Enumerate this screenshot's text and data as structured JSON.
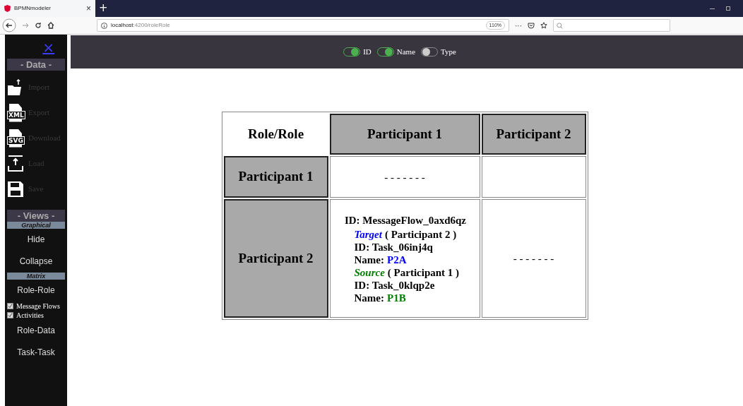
{
  "browser": {
    "tab_title": "BPMNmodeler",
    "tab_close": "×",
    "new_tab": "+",
    "url_host": "localhost",
    "url_path": ":4200/roleRole",
    "zoom": "110%",
    "more": "···"
  },
  "sidebar": {
    "close": "×",
    "data_header": "- Data -",
    "data_items": [
      {
        "kind": "import",
        "label": "Import",
        "disabled": true
      },
      {
        "kind": "xml",
        "badge": "XML",
        "label": "Export",
        "disabled": true
      },
      {
        "kind": "svg",
        "badge": "SVG",
        "label": "Download",
        "disabled": true
      },
      {
        "kind": "load",
        "label": "Load",
        "disabled": true
      },
      {
        "kind": "save",
        "label": "Save",
        "disabled": true
      }
    ],
    "views_header": "- Views -",
    "sections": [
      {
        "title": "Graphical",
        "items": [
          {
            "kind": "link",
            "label": "Hide"
          },
          {
            "kind": "link",
            "label": "Collapse"
          }
        ]
      },
      {
        "title": "Matrix",
        "items": [
          {
            "kind": "link",
            "label": "Role-Role"
          },
          {
            "kind": "checkbox",
            "label": "Message Flows",
            "checked": true
          },
          {
            "kind": "checkbox",
            "label": "Activities",
            "checked": true
          },
          {
            "kind": "link",
            "label": "Role-Data"
          },
          {
            "kind": "link",
            "label": "Task-Task"
          }
        ]
      }
    ]
  },
  "toggles": [
    {
      "label": "ID",
      "on": true
    },
    {
      "label": "Name",
      "on": true
    },
    {
      "label": "Type",
      "on": false
    }
  ],
  "matrix": {
    "corner": "Role/Role",
    "columns": [
      "Participant 1",
      "Participant 2"
    ],
    "rows": [
      {
        "header": "Participant 1",
        "cells": [
          {
            "kind": "empty",
            "text": "- - - - - - -"
          },
          {
            "kind": "blank"
          }
        ]
      },
      {
        "header": "Participant 2",
        "cells": [
          {
            "kind": "flow",
            "id": "ID: MessageFlow_0axd6qz",
            "ends": [
              {
                "label": "Target",
                "color": "#0000ff",
                "participant": "( Participant 2 )",
                "id": "ID: Task_06inj4q",
                "name_label": "Name:",
                "name": "P2A"
              },
              {
                "label": "Source",
                "color": "#008000",
                "participant": "( Participant 1 )",
                "id": "ID: Task_0klqp2e",
                "name_label": "Name:",
                "name": "P1B"
              }
            ]
          },
          {
            "kind": "empty",
            "text": "- - - - - - -"
          }
        ]
      }
    ]
  }
}
